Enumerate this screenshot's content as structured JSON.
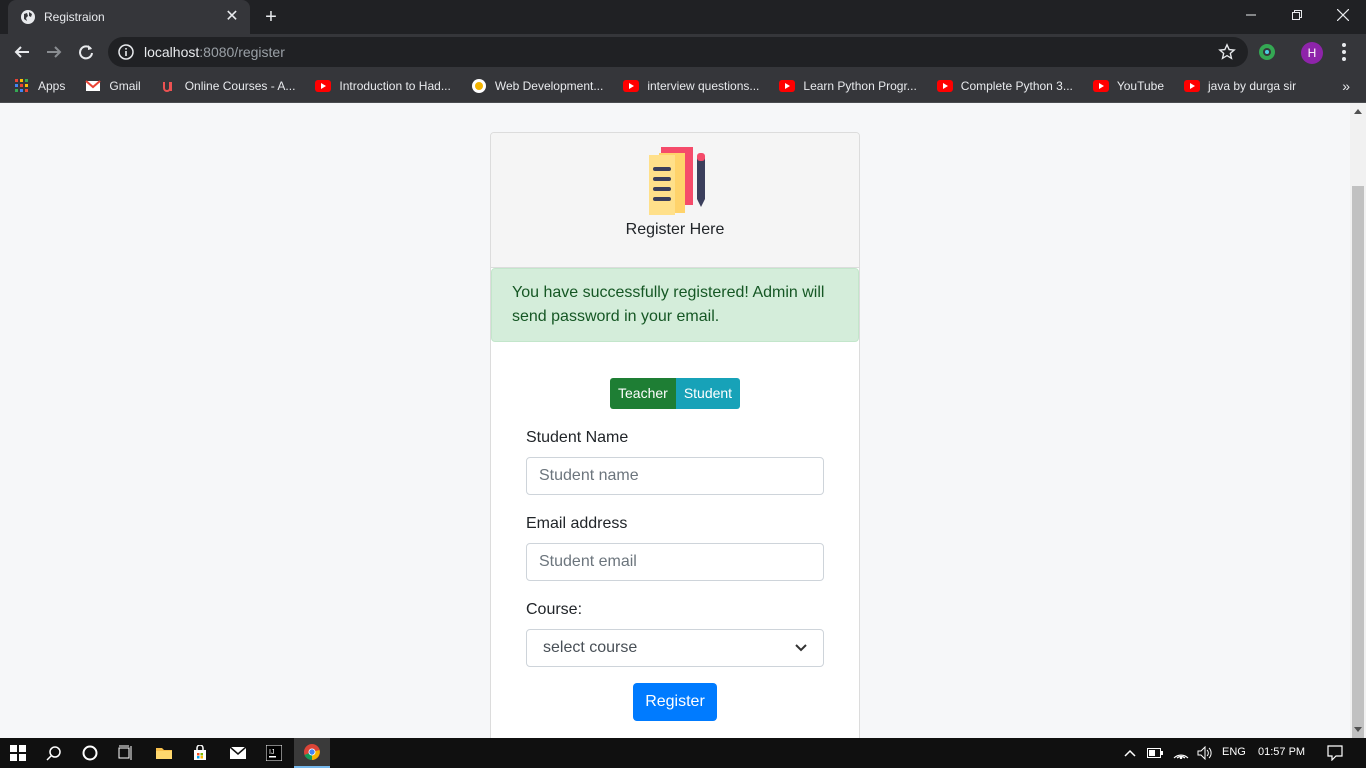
{
  "browser": {
    "tab_title": "Registraion",
    "url_host": "localhost",
    "url_path": ":8080/register",
    "avatar_letter": "H"
  },
  "bookmarks": [
    {
      "label": "Apps",
      "icon": "apps-grid-icon"
    },
    {
      "label": "Gmail",
      "icon": "gmail-icon"
    },
    {
      "label": "Online Courses - A...",
      "icon": "udemy-icon"
    },
    {
      "label": "Introduction to Had...",
      "icon": "youtube-icon"
    },
    {
      "label": "Web Development...",
      "icon": "web-icon"
    },
    {
      "label": "interview questions...",
      "icon": "youtube-icon"
    },
    {
      "label": "Learn Python Progr...",
      "icon": "youtube-icon"
    },
    {
      "label": "Complete Python 3...",
      "icon": "youtube-icon"
    },
    {
      "label": "YouTube",
      "icon": "youtube-icon"
    },
    {
      "label": "java by durga sir",
      "icon": "youtube-icon"
    }
  ],
  "page": {
    "header_title": "Register Here",
    "alert": "You have successfully registered! Admin will send password in your email.",
    "roles": {
      "teacher": "Teacher",
      "student": "Student"
    },
    "name_label": "Student Name",
    "name_placeholder": "Student name",
    "email_label": "Email address",
    "email_placeholder": "Student email",
    "course_label": "Course:",
    "course_selected": "select course",
    "register_button": "Register"
  },
  "taskbar": {
    "language": "ENG",
    "time": "01:57 PM"
  },
  "colors": {
    "alert_bg": "#d4edda",
    "teacher_btn": "#1e7e34",
    "student_btn": "#17a2b8",
    "primary": "#007bff"
  }
}
